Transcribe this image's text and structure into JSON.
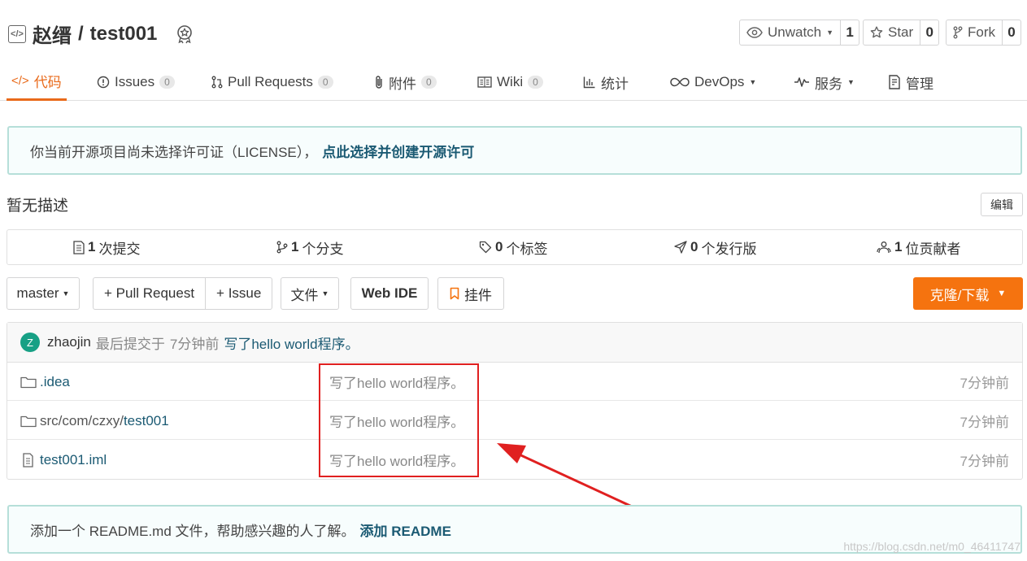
{
  "header": {
    "owner": "赵缙",
    "separator": "/",
    "repo": "test001",
    "code_icon_text": "</>",
    "watch": {
      "label": "Unwatch",
      "count": "1"
    },
    "star": {
      "label": "Star",
      "count": "0"
    },
    "fork": {
      "label": "Fork",
      "count": "0"
    }
  },
  "tabs": [
    {
      "label": "代码",
      "icon": "code-icon"
    },
    {
      "label": "Issues",
      "count": "0",
      "icon": "issue-icon"
    },
    {
      "label": "Pull Requests",
      "count": "0",
      "icon": "pull-request-icon"
    },
    {
      "label": "附件",
      "count": "0",
      "icon": "attachment-icon"
    },
    {
      "label": "Wiki",
      "count": "0",
      "icon": "book-icon"
    },
    {
      "label": "统计",
      "icon": "chart-icon"
    },
    {
      "label": "DevOps",
      "icon": "infinity-icon"
    },
    {
      "label": "服务",
      "icon": "pulse-icon"
    },
    {
      "label": "管理",
      "icon": "settings-doc-icon"
    }
  ],
  "license_notice": {
    "text": "你当前开源项目尚未选择许可证（LICENSE），",
    "link": "点此选择并创建开源许可"
  },
  "description": {
    "text": "暂无描述",
    "edit_label": "编辑"
  },
  "stats": [
    {
      "count": "1",
      "label": "次提交",
      "icon": "commit-icon"
    },
    {
      "count": "1",
      "label": "个分支",
      "icon": "branch-icon"
    },
    {
      "count": "0",
      "label": "个标签",
      "icon": "tag-icon"
    },
    {
      "count": "0",
      "label": "个发行版",
      "icon": "release-icon"
    },
    {
      "count": "1",
      "label": "位贡献者",
      "icon": "contributors-icon"
    }
  ],
  "toolbar": {
    "branch": "master",
    "pull_request": "+ Pull Request",
    "issue": "+ Issue",
    "file": "文件",
    "web_ide": "Web IDE",
    "widget": "挂件",
    "clone": "克隆/下载"
  },
  "last_commit": {
    "avatar_letter": "Z",
    "user": "zhaojin",
    "action": "最后提交于",
    "time": "7分钟前",
    "message": "写了hello world程序。"
  },
  "files": [
    {
      "type": "folder",
      "name": ".idea",
      "prefix": "",
      "message": "写了hello world程序。",
      "time": "7分钟前"
    },
    {
      "type": "folder",
      "name": "test001",
      "prefix": "src/com/czxy/",
      "message": "写了hello world程序。",
      "time": "7分钟前"
    },
    {
      "type": "file",
      "name": "test001.iml",
      "prefix": "",
      "message": "写了hello world程序。",
      "time": "7分钟前"
    }
  ],
  "readme_notice": {
    "text": "添加一个 README.md 文件，帮助感兴趣的人了解。",
    "link": "添加 README"
  },
  "watermark": "https://blog.csdn.net/m0_46411747",
  "colors": {
    "accent": "#e96a1a",
    "clone_button": "#f5730f",
    "link": "#1b5a73",
    "annotation": "#e02020"
  }
}
